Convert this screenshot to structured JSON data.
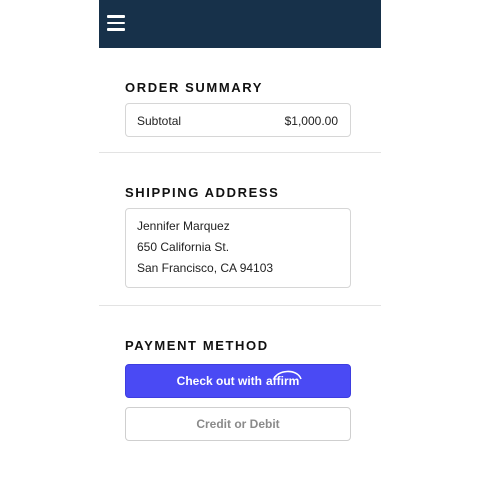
{
  "header": {
    "menu_icon": "hamburger-menu-icon",
    "bg_color": "#17314a"
  },
  "order_summary": {
    "title": "ORDER SUMMARY",
    "rows": [
      {
        "label": "Subtotal",
        "value": "$1,000.00"
      }
    ]
  },
  "shipping": {
    "title": "SHIPPING ADDRESS",
    "lines": [
      "Jennifer Marquez",
      "650 California St.",
      "San Francisco, CA 94103"
    ]
  },
  "payment": {
    "title": "PAYMENT METHOD",
    "affirm_button": {
      "prefix": "Check out with",
      "brand": "affirm",
      "color": "#4a4af4"
    },
    "card_button": {
      "label": "Credit or Debit"
    }
  }
}
